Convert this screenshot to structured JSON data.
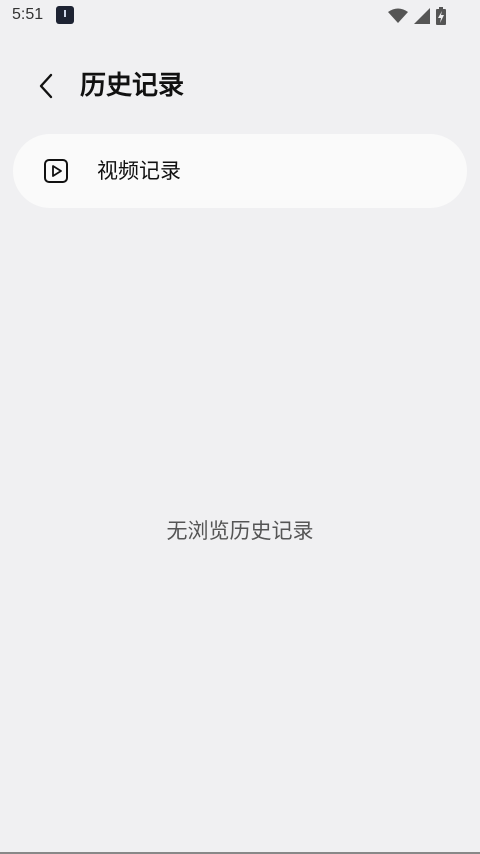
{
  "status_bar": {
    "time": "5:51"
  },
  "header": {
    "title": "历史记录"
  },
  "items": [
    {
      "label": "视频记录",
      "icon": "video-play-icon"
    }
  ],
  "empty_state": {
    "text": "无浏览历史记录"
  },
  "colors": {
    "background": "#f0f0f2",
    "card": "#fafafa",
    "text_primary": "#111111",
    "text_secondary": "#555555"
  }
}
